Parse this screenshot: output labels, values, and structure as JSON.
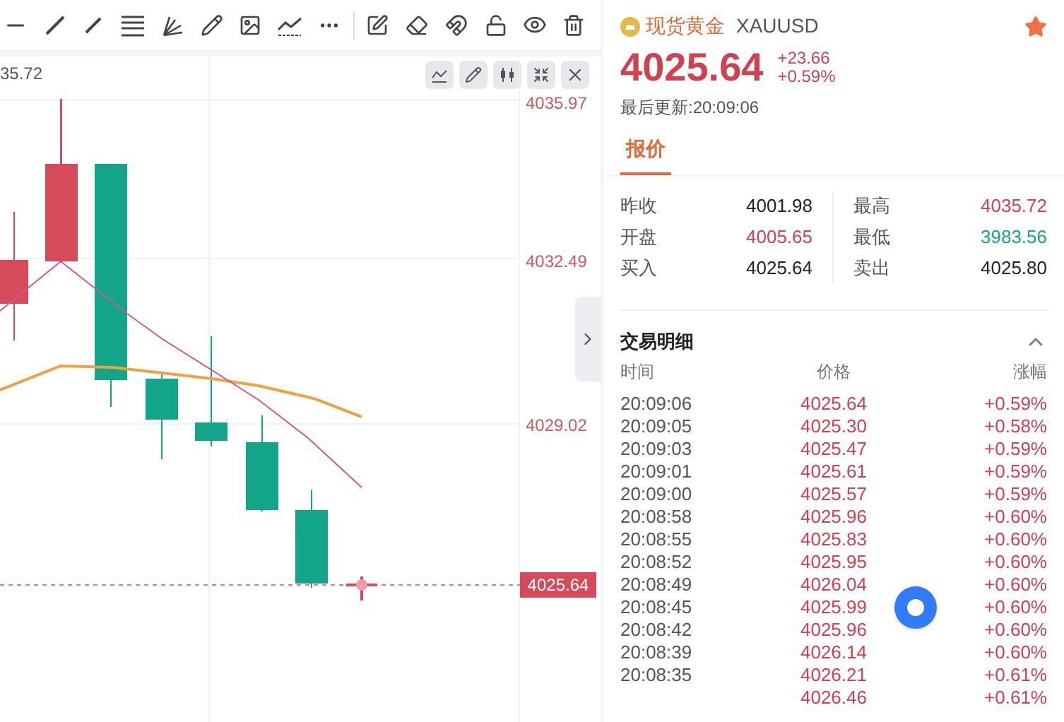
{
  "chart": {
    "high_marker": "35.72",
    "axis_labels": [
      "4035.97",
      "4032.49",
      "4029.02"
    ],
    "current_price": "4025.64"
  },
  "quote": {
    "name": "现货黄金",
    "symbol": "XAUUSD",
    "favorite": true,
    "price": "4025.64",
    "change": "+23.66",
    "change_pct": "+0.59%",
    "updated": "最后更新:20:09:06"
  },
  "tabs": [
    {
      "label": "报价",
      "selected": true
    }
  ],
  "stats": [
    {
      "label": "昨收",
      "value": "4001.98",
      "color": "#222222"
    },
    {
      "label": "最高",
      "value": "4035.72",
      "color": "#d2414f"
    },
    {
      "label": "开盘",
      "value": "4005.65",
      "color": "#d2414f"
    },
    {
      "label": "最低",
      "value": "3983.56",
      "color": "#13a58a"
    },
    {
      "label": "买入",
      "value": "4025.64",
      "color": "#222222"
    },
    {
      "label": "卖出",
      "value": "4025.80",
      "color": "#222222"
    }
  ],
  "trades": {
    "title": "交易明细",
    "expanded": true,
    "columns": [
      "时间",
      "价格",
      "涨幅"
    ],
    "rows": [
      {
        "time": "20:09:06",
        "price": "4025.64",
        "pct": "+0.59%"
      },
      {
        "time": "20:09:05",
        "price": "4025.30",
        "pct": "+0.58%"
      },
      {
        "time": "20:09:03",
        "price": "4025.47",
        "pct": "+0.59%"
      },
      {
        "time": "20:09:01",
        "price": "4025.61",
        "pct": "+0.59%"
      },
      {
        "time": "20:09:00",
        "price": "4025.57",
        "pct": "+0.59%"
      },
      {
        "time": "20:08:58",
        "price": "4025.96",
        "pct": "+0.60%"
      },
      {
        "time": "20:08:55",
        "price": "4025.83",
        "pct": "+0.60%"
      },
      {
        "time": "20:08:52",
        "price": "4025.95",
        "pct": "+0.60%"
      },
      {
        "time": "20:08:49",
        "price": "4026.04",
        "pct": "+0.60%"
      },
      {
        "time": "20:08:45",
        "price": "4025.99",
        "pct": "+0.60%"
      },
      {
        "time": "20:08:42",
        "price": "4025.96",
        "pct": "+0.60%"
      },
      {
        "time": "20:08:39",
        "price": "4026.14",
        "pct": "+0.60%"
      },
      {
        "time": "20:08:35",
        "price": "4026.21",
        "pct": "+0.61%"
      },
      {
        "price": "4026.46",
        "pct": "+0.61%"
      }
    ]
  }
}
